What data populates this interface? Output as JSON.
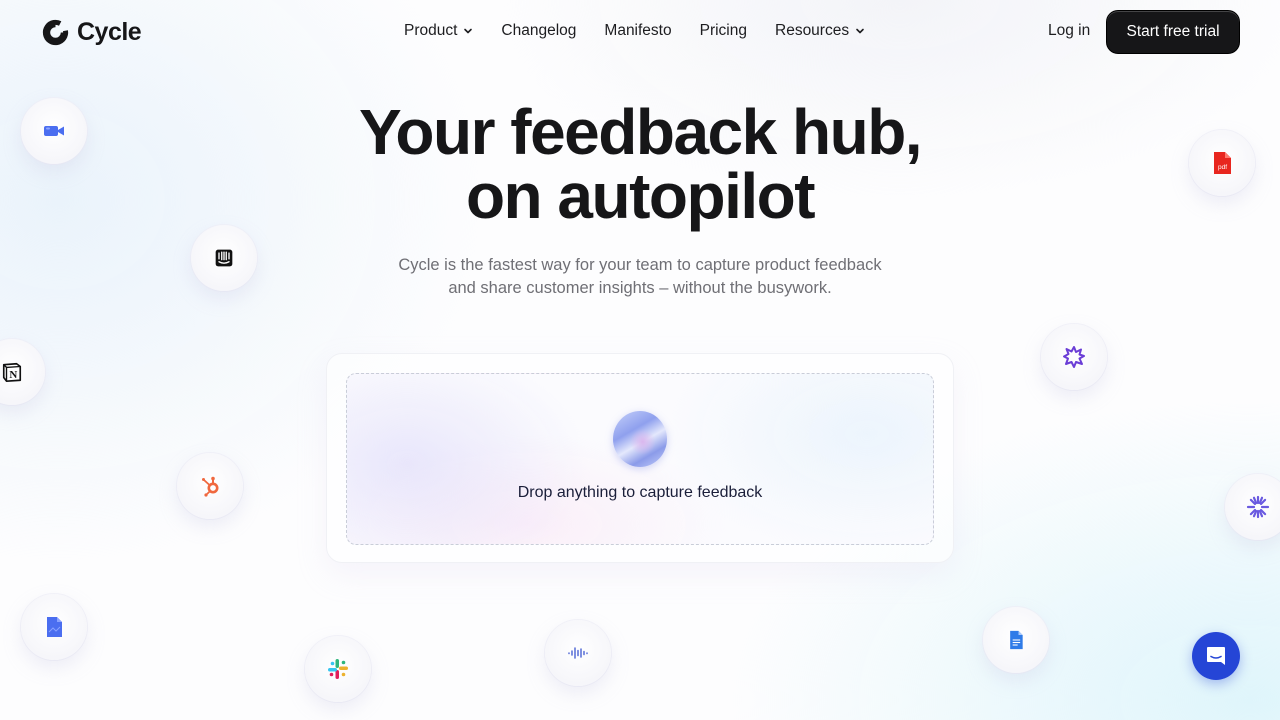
{
  "brand": {
    "name": "Cycle"
  },
  "nav": {
    "items": [
      {
        "label": "Product",
        "has_dropdown": true
      },
      {
        "label": "Changelog",
        "has_dropdown": false
      },
      {
        "label": "Manifesto",
        "has_dropdown": false
      },
      {
        "label": "Pricing",
        "has_dropdown": false
      },
      {
        "label": "Resources",
        "has_dropdown": true
      }
    ],
    "login_label": "Log in",
    "cta_label": "Start free trial"
  },
  "hero": {
    "title_line1": "Your feedback hub,",
    "title_line2": "on autopilot",
    "subtitle_line1": "Cycle is the fastest way for your team to capture product feedback",
    "subtitle_line2": "and share customer insights – without the busywork."
  },
  "dropzone": {
    "label": "Drop anything to capture feedback"
  },
  "integrations": [
    {
      "name": "zoom-video",
      "icon": "video-camera-icon",
      "color": "#4b6ef0"
    },
    {
      "name": "intercom",
      "icon": "intercom-icon",
      "color": "#111111"
    },
    {
      "name": "notion",
      "icon": "notion-icon",
      "color": "#111111"
    },
    {
      "name": "hubspot",
      "icon": "hubspot-icon",
      "color": "#f0683f"
    },
    {
      "name": "file",
      "icon": "file-icon",
      "color": "#4b6ef0"
    },
    {
      "name": "slack",
      "icon": "slack-icon",
      "color": "#e01e5a"
    },
    {
      "name": "audio",
      "icon": "audio-wave-icon",
      "color": "#5f74d9"
    },
    {
      "name": "pdf",
      "icon": "pdf-icon",
      "color": "#e8261f",
      "text": "pdf"
    },
    {
      "name": "starburst-app",
      "icon": "starburst-icon",
      "color": "#6b3ed6"
    },
    {
      "name": "asterisk-app",
      "icon": "asterisk-icon",
      "color": "#6a5ae0"
    },
    {
      "name": "google-docs",
      "icon": "google-docs-icon",
      "color": "#2f7be8"
    }
  ],
  "chat_widget": {
    "icon": "chat-icon",
    "color": "#2545d6"
  }
}
